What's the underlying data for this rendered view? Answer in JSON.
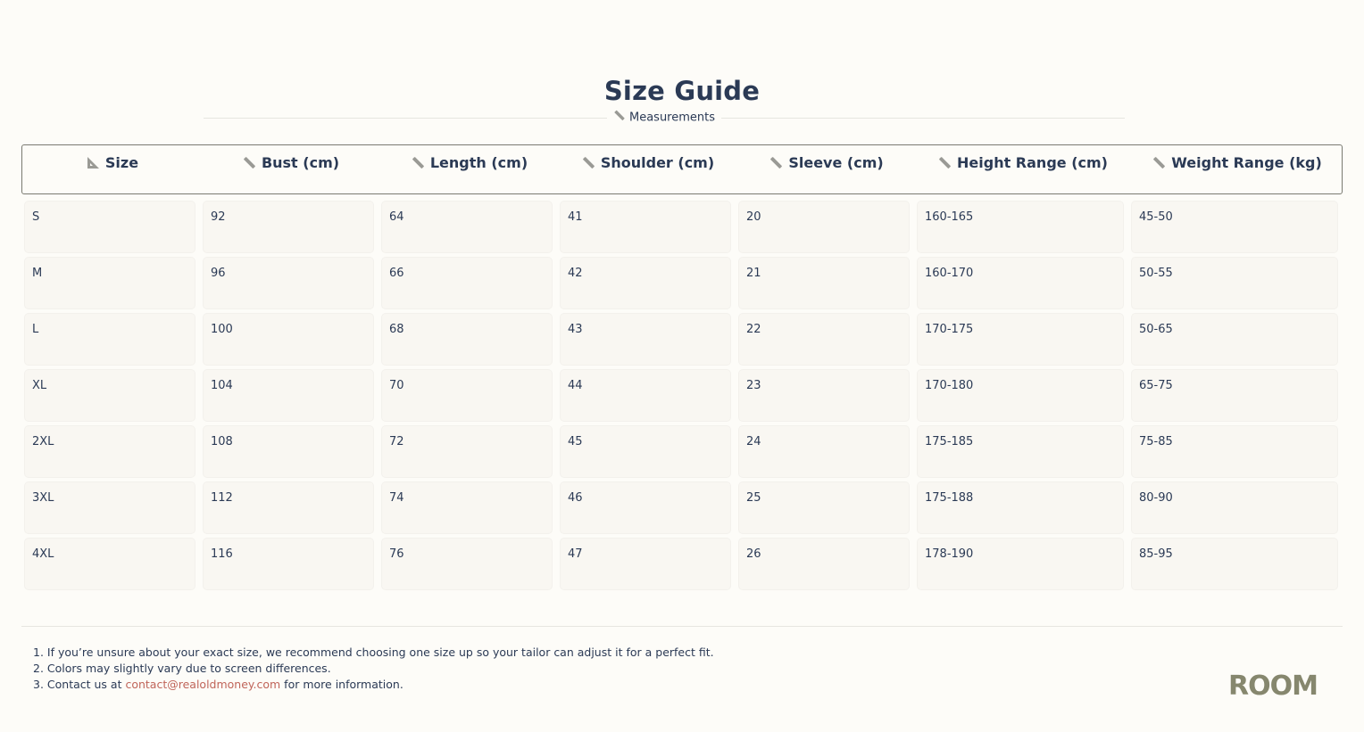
{
  "page": {
    "title": "Size Guide",
    "section_label": "Measurements"
  },
  "table": {
    "columns": [
      {
        "label": "Size",
        "icon": "set-square-icon"
      },
      {
        "label": "Bust (cm)",
        "icon": "ruler-icon"
      },
      {
        "label": "Length (cm)",
        "icon": "ruler-icon"
      },
      {
        "label": "Shoulder (cm)",
        "icon": "ruler-icon"
      },
      {
        "label": "Sleeve (cm)",
        "icon": "ruler-icon"
      },
      {
        "label": "Height Range (cm)",
        "icon": "ruler-icon"
      },
      {
        "label": "Weight Range (kg)",
        "icon": "ruler-icon"
      }
    ],
    "rows": [
      [
        "S",
        "92",
        "64",
        "41",
        "20",
        "160-165",
        "45-50"
      ],
      [
        "M",
        "96",
        "66",
        "42",
        "21",
        "160-170",
        "50-55"
      ],
      [
        "L",
        "100",
        "68",
        "43",
        "22",
        "170-175",
        "50-65"
      ],
      [
        "XL",
        "104",
        "70",
        "44",
        "23",
        "170-180",
        "65-75"
      ],
      [
        "2XL",
        "108",
        "72",
        "45",
        "24",
        "175-185",
        "75-85"
      ],
      [
        "3XL",
        "112",
        "74",
        "46",
        "25",
        "175-188",
        "80-90"
      ],
      [
        "4XL",
        "116",
        "76",
        "47",
        "26",
        "178-190",
        "85-95"
      ]
    ]
  },
  "notes": {
    "line1": "1. If you’re unsure about your exact size, we recommend choosing one size up so your tailor can adjust it for a perfect fit.",
    "line2": "2. Colors may slightly vary due to screen differences.",
    "line3_prefix": "3. Contact us at ",
    "email": "contact@realoldmoney.com",
    "line3_suffix": " for more information."
  },
  "brand": {
    "logo_text": "ROOM"
  },
  "colors": {
    "background": "#fdfcf8",
    "text": "#2b3a55",
    "link": "#c0655a",
    "logo": "#86876e",
    "cell": "#f9f7f2"
  }
}
